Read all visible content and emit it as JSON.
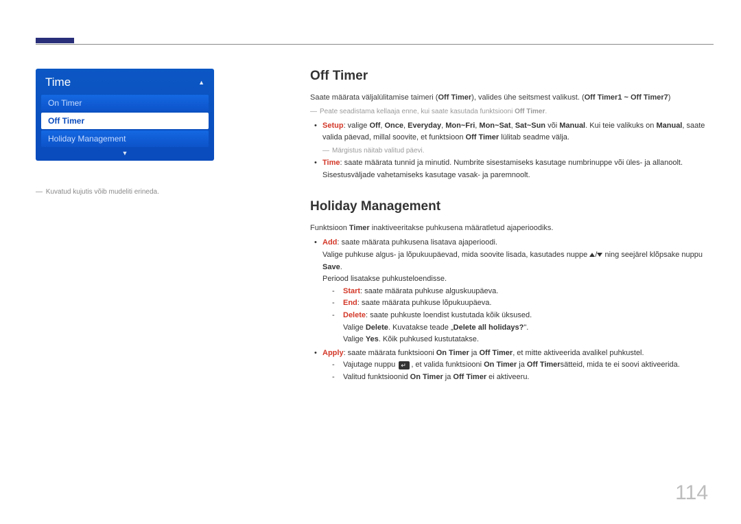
{
  "page_number": "114",
  "menu": {
    "title": "Time",
    "items": [
      {
        "label": "On Timer",
        "selected": false
      },
      {
        "label": "Off Timer",
        "selected": true
      },
      {
        "label": "Holiday Management",
        "selected": false
      }
    ]
  },
  "caption_prefix": "― ",
  "caption": "Kuvatud kujutis võib mudeliti erineda.",
  "offtimer": {
    "heading": "Off Timer",
    "intro_pre": "Saate määrata väljalülitamise taimeri (",
    "intro_bold1": "Off Timer",
    "intro_mid": "), valides ühe seitsmest valikust. (",
    "intro_bold2": "Off Timer1 ~ Off Timer7",
    "intro_post": ")",
    "note_pre": "Peate seadistama kellaaja enne, kui saate kasutada funktsiooni ",
    "note_bold": "Off Timer",
    "note_post": ".",
    "setup_label": "Setup",
    "setup_pre": ": valige ",
    "setup_opts": [
      "Off",
      "Once",
      "Everyday",
      "Mon~Fri",
      "Mon~Sat",
      "Sat~Sun"
    ],
    "setup_or": " või ",
    "setup_manual": "Manual",
    "setup_mid": ". Kui teie valikuks on ",
    "setup_post": ", saate valida päevad, millal soovite, et funktsioon ",
    "setup_off_timer": "Off Timer",
    "setup_tail": " lülitab seadme välja.",
    "setup_note": "Märgistus näitab valitud päevi.",
    "time_label": "Time",
    "time_text": ": saate määrata tunnid ja minutid. Numbrite sisestamiseks kasutage numbrinuppe või üles- ja allanoolt. Sisestusväljade vahetamiseks kasutage vasak- ja paremnoolt."
  },
  "holiday": {
    "heading": "Holiday Management",
    "intro_pre": "Funktsioon ",
    "intro_bold": "Timer",
    "intro_post": " inaktiveeritakse puhkusena määratletud ajaperioodiks.",
    "add_label": "Add",
    "add_text": ": saate määrata puhkusena lisatava ajaperioodi.",
    "add_line2_pre": "Valige puhkuse algus- ja lõpukuupäevad, mida soovite lisada, kasutades nuppe ",
    "add_line2_mid": " ning seejärel klõpsake nuppu ",
    "add_line2_save": "Save",
    "add_line2_post": ".",
    "add_line3": "Periood lisatakse puhkusteloendisse.",
    "start_label": "Start",
    "start_text": ": saate määrata puhkuse alguskuupäeva.",
    "end_label": "End",
    "end_text": ": saate määrata puhkuse lõpukuupäeva.",
    "delete_label": "Delete",
    "delete_text": ": saate puhkuste loendist kustutada kõik üksused.",
    "delete_sub1a": "Valige ",
    "delete_sub1b": "Delete",
    "delete_sub1c": ". Kuvatakse teade „",
    "delete_sub1d": "Delete all holidays?",
    "delete_sub1e": "\".",
    "delete_sub2a": "Valige ",
    "delete_sub2b": "Yes",
    "delete_sub2c": ". Kõik puhkused kustutatakse.",
    "apply_label": "Apply",
    "apply_pre": ": saate määrata funktsiooni ",
    "apply_on": "On Timer",
    "apply_mid1": " ja ",
    "apply_off": "Off Timer",
    "apply_post": ", et mitte aktiveerida avalikel puhkustel.",
    "apply_sub1_pre": "Vajutage nuppu ",
    "apply_sub1_mid": ", et valida funktsiooni ",
    "apply_sub1_tail": "sätteid, mida te ei soovi aktiveerida.",
    "apply_sub2_pre": "Valitud funktsioonid ",
    "apply_sub2_tail": " ei aktiveeru."
  }
}
